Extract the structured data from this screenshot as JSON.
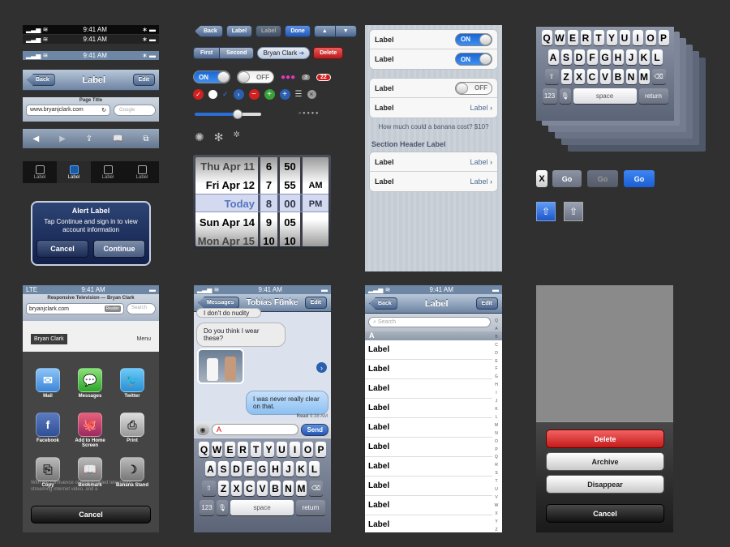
{
  "status": {
    "time": "9:41 AM",
    "carrier_lte": "LTE"
  },
  "nav": {
    "back": "Back",
    "title": "Label",
    "edit": "Edit"
  },
  "browser": {
    "page_title": "Page Title",
    "url": "www.bryanjclark.com",
    "search_placeholder": "Google"
  },
  "tabbar": {
    "items": [
      "Label",
      "Label",
      "Label",
      "Label"
    ]
  },
  "alert": {
    "title": "Alert Label",
    "message": "Tap Continue and sign in to view account information",
    "cancel": "Cancel",
    "continue": "Continue"
  },
  "controls": {
    "back": "Back",
    "label1": "Label",
    "label2": "Label",
    "done": "Done",
    "seg_first": "First",
    "seg_second": "Second",
    "token": "Bryan Clark",
    "delete": "Delete",
    "switch_on": "ON",
    "switch_off": "OFF",
    "badge_count": "3",
    "badge_red": "22"
  },
  "picker": {
    "dates": [
      "Thu Apr 11",
      "Fri Apr 12",
      "Today",
      "Sun Apr 14",
      "Mon Apr 15"
    ],
    "hours": [
      "6",
      "7",
      "8",
      "9",
      "10"
    ],
    "minutes": [
      "50",
      "55",
      "00",
      "05",
      "10"
    ],
    "ampm": [
      "",
      "AM",
      "PM",
      "",
      ""
    ]
  },
  "settings": {
    "rows_a": [
      {
        "label": "Label",
        "toggle": "ON"
      },
      {
        "label": "Label",
        "toggle": "ON"
      }
    ],
    "rows_b": [
      {
        "label": "Label",
        "toggle": "OFF"
      },
      {
        "label": "Label",
        "detail": "Label"
      }
    ],
    "footer": "How much could a banana cost? $10?",
    "section_header": "Section Header Label",
    "rows_c": [
      {
        "label": "Label",
        "detail": "Label"
      },
      {
        "label": "Label",
        "detail": "Label"
      }
    ]
  },
  "keyboard": {
    "row1": [
      "Q",
      "W",
      "E",
      "R",
      "T",
      "Y",
      "U",
      "I",
      "O",
      "P"
    ],
    "row2": [
      "A",
      "S",
      "D",
      "F",
      "G",
      "H",
      "J",
      "K",
      "L"
    ],
    "row3": [
      "Z",
      "X",
      "C",
      "V",
      "B",
      "N",
      "M"
    ],
    "num": "123",
    "space": "space",
    "return": "return"
  },
  "gobuttons": {
    "x": "X",
    "go1": "Go",
    "go2": "Go",
    "go3": "Go"
  },
  "share": {
    "page_title": "Responsive Television — Bryan Clark",
    "url": "bryanjclark.com",
    "reader": "Reader",
    "search": "Search",
    "site_name": "Bryan Clark",
    "menu": "Menu",
    "items": [
      {
        "label": "Mail",
        "icon": "mail-icon"
      },
      {
        "label": "Messages",
        "icon": "messages-icon"
      },
      {
        "label": "Twitter",
        "icon": "twitter-icon"
      },
      {
        "label": "Facebook",
        "icon": "facebook-icon"
      },
      {
        "label": "Add to Home Screen",
        "icon": "add-home-icon"
      },
      {
        "label": "Print",
        "icon": "print-icon"
      },
      {
        "label": "Copy",
        "icon": "copy-icon"
      },
      {
        "label": "Bookmark",
        "icon": "bookmark-icon"
      },
      {
        "label": "Banana Stand",
        "icon": "banana-icon"
      }
    ],
    "cancel": "Cancel",
    "bg_text": "With the confluence of web-enabled televisions, streaming internet video, and a"
  },
  "messages": {
    "back": "Messages",
    "name": "Tobias Fünke",
    "edit": "Edit",
    "b1": "I don't do nudity",
    "b2": "Do you think I wear these?",
    "b3": "I was never really clear on that.",
    "read": "Read",
    "read_time": "9:38 AM",
    "input": "A",
    "send": "Send"
  },
  "list": {
    "back": "Back",
    "title": "Label",
    "edit": "Edit",
    "search": "Search",
    "section": "A",
    "rows": [
      "Label",
      "Label",
      "Label",
      "Label",
      "Label",
      "Label",
      "Label",
      "Label",
      "Label",
      "Label",
      "Label",
      "Label"
    ],
    "index": [
      "Q",
      "A",
      "B",
      "C",
      "D",
      "E",
      "F",
      "G",
      "H",
      "I",
      "J",
      "K",
      "L",
      "M",
      "N",
      "O",
      "P",
      "Q",
      "R",
      "S",
      "T",
      "U",
      "V",
      "W",
      "X",
      "Y",
      "Z"
    ]
  },
  "actionsheet": {
    "delete": "Delete",
    "archive": "Archive",
    "disappear": "Disappear",
    "cancel": "Cancel"
  },
  "colors": {
    "nav_blue": "#6d84a3",
    "ios_blue": "#1a67d2",
    "delete_red": "#d72332",
    "bg": "#303030"
  }
}
